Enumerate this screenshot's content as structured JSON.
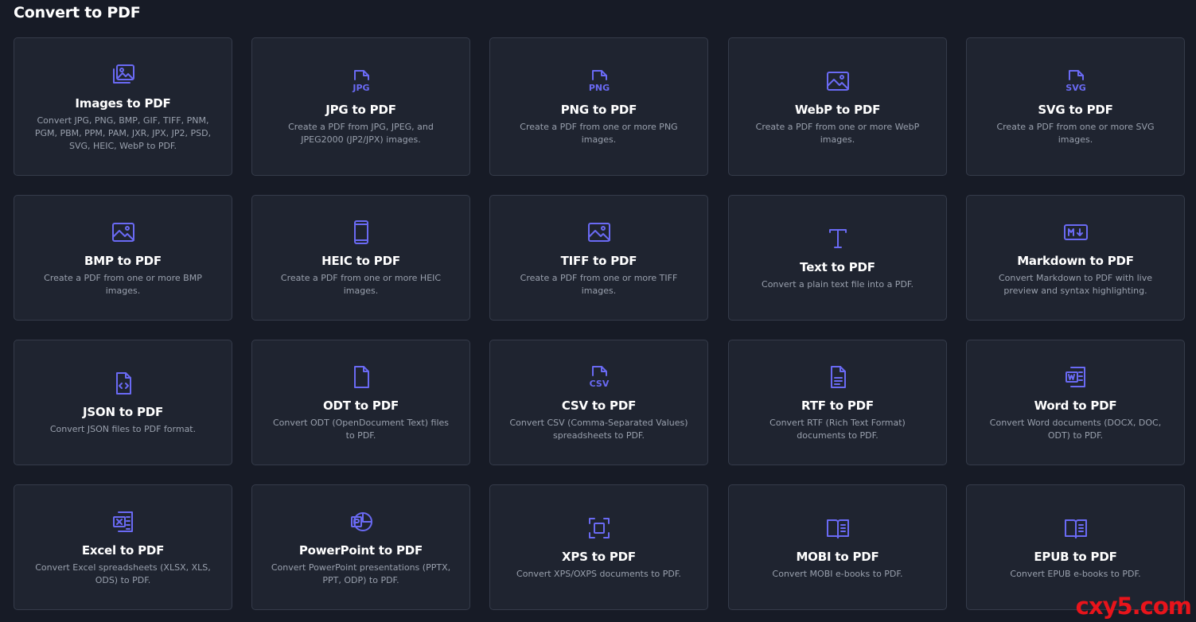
{
  "page": {
    "title": "Convert to PDF"
  },
  "accent_color": "#6a6af4",
  "cards": [
    {
      "name": "images-to-pdf-card",
      "icon": "images-icon",
      "icon_text": "",
      "title": "Images to PDF",
      "desc": "Convert JPG, PNG, BMP, GIF, TIFF, PNM, PGM, PBM, PPM, PAM, JXR, JPX, JP2, PSD, SVG, HEIC, WebP to PDF."
    },
    {
      "name": "jpg-to-pdf-card",
      "icon": "jpg-file-icon",
      "icon_text": "JPG",
      "title": "JPG to PDF",
      "desc": "Create a PDF from JPG, JPEG, and JPEG2000 (JP2/JPX) images."
    },
    {
      "name": "png-to-pdf-card",
      "icon": "png-file-icon",
      "icon_text": "PNG",
      "title": "PNG to PDF",
      "desc": "Create a PDF from one or more PNG images."
    },
    {
      "name": "webp-to-pdf-card",
      "icon": "image-icon",
      "icon_text": "",
      "title": "WebP to PDF",
      "desc": "Create a PDF from one or more WebP images."
    },
    {
      "name": "svg-to-pdf-card",
      "icon": "svg-file-icon",
      "icon_text": "SVG",
      "title": "SVG to PDF",
      "desc": "Create a PDF from one or more SVG images."
    },
    {
      "name": "bmp-to-pdf-card",
      "icon": "image-icon",
      "icon_text": "",
      "title": "BMP to PDF",
      "desc": "Create a PDF from one or more BMP images."
    },
    {
      "name": "heic-to-pdf-card",
      "icon": "phone-icon",
      "icon_text": "",
      "title": "HEIC to PDF",
      "desc": "Create a PDF from one or more HEIC images."
    },
    {
      "name": "tiff-to-pdf-card",
      "icon": "image-icon",
      "icon_text": "",
      "title": "TIFF to PDF",
      "desc": "Create a PDF from one or more TIFF images."
    },
    {
      "name": "text-to-pdf-card",
      "icon": "text-icon",
      "icon_text": "",
      "title": "Text to PDF",
      "desc": "Convert a plain text file into a PDF."
    },
    {
      "name": "markdown-to-pdf-card",
      "icon": "markdown-icon",
      "icon_text": "",
      "title": "Markdown to PDF",
      "desc": "Convert Markdown to PDF with live preview and syntax highlighting."
    },
    {
      "name": "json-to-pdf-card",
      "icon": "code-file-icon",
      "icon_text": "",
      "title": "JSON to PDF",
      "desc": "Convert JSON files to PDF format."
    },
    {
      "name": "odt-to-pdf-card",
      "icon": "file-icon",
      "icon_text": "",
      "title": "ODT to PDF",
      "desc": "Convert ODT (OpenDocument Text) files to PDF."
    },
    {
      "name": "csv-to-pdf-card",
      "icon": "csv-file-icon",
      "icon_text": "CSV",
      "title": "CSV to PDF",
      "desc": "Convert CSV (Comma-Separated Values) spreadsheets to PDF."
    },
    {
      "name": "rtf-to-pdf-card",
      "icon": "text-file-icon",
      "icon_text": "",
      "title": "RTF to PDF",
      "desc": "Convert RTF (Rich Text Format) documents to PDF."
    },
    {
      "name": "word-to-pdf-card",
      "icon": "word-icon",
      "icon_text": "",
      "title": "Word to PDF",
      "desc": "Convert Word documents (DOCX, DOC, ODT) to PDF."
    },
    {
      "name": "excel-to-pdf-card",
      "icon": "excel-icon",
      "icon_text": "",
      "title": "Excel to PDF",
      "desc": "Convert Excel spreadsheets (XLSX, XLS, ODS) to PDF."
    },
    {
      "name": "powerpoint-to-pdf-card",
      "icon": "powerpoint-icon",
      "icon_text": "",
      "title": "PowerPoint to PDF",
      "desc": "Convert PowerPoint presentations (PPTX, PPT, ODP) to PDF."
    },
    {
      "name": "xps-to-pdf-card",
      "icon": "scan-icon",
      "icon_text": "",
      "title": "XPS to PDF",
      "desc": "Convert XPS/OXPS documents to PDF."
    },
    {
      "name": "mobi-to-pdf-card",
      "icon": "book-icon",
      "icon_text": "",
      "title": "MOBI to PDF",
      "desc": "Convert MOBI e-books to PDF."
    },
    {
      "name": "epub-to-pdf-card",
      "icon": "book-icon",
      "icon_text": "",
      "title": "EPUB to PDF",
      "desc": "Convert EPUB e-books to PDF."
    }
  ],
  "watermark": {
    "text": "cxy5.com"
  }
}
